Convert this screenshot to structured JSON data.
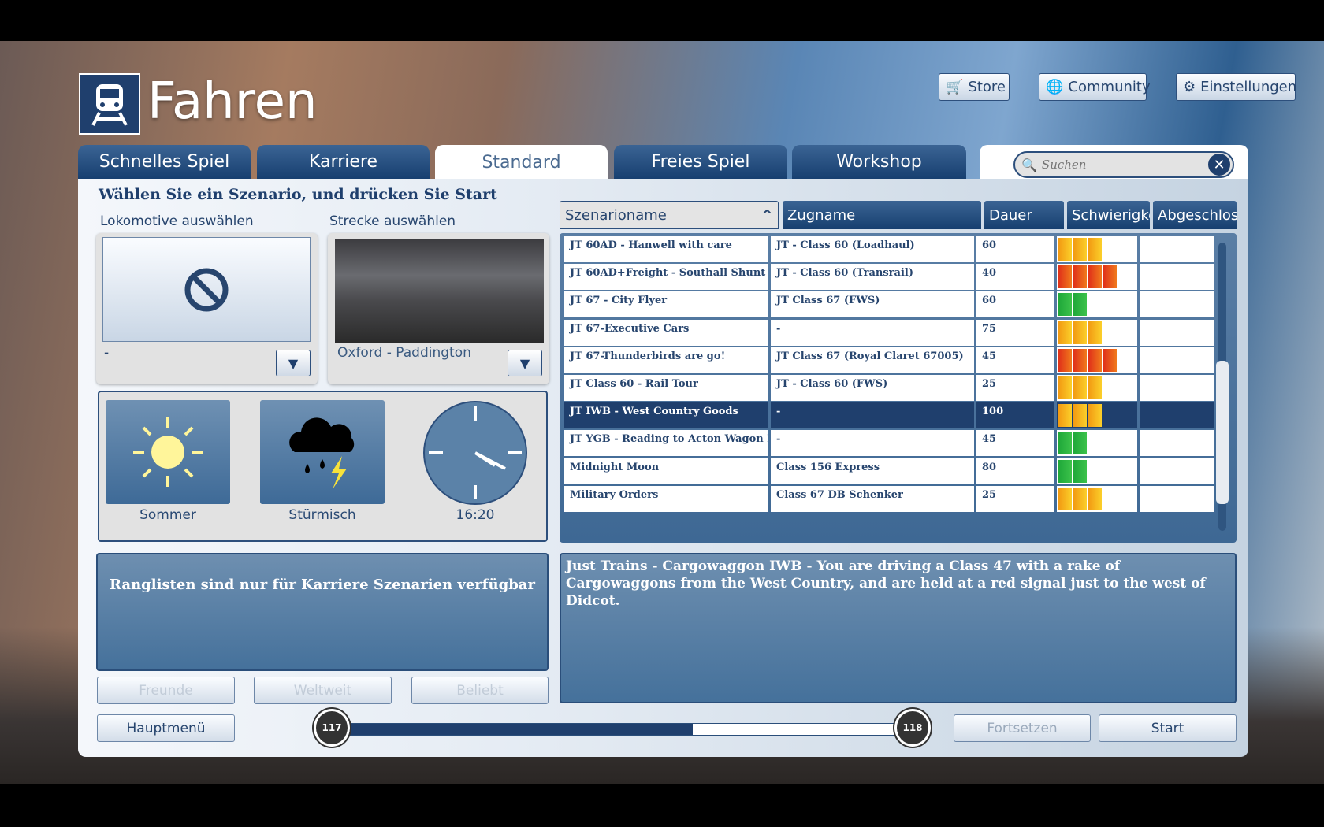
{
  "header": {
    "title": "Fahren",
    "logo_icon": "train-icon"
  },
  "top_buttons": [
    {
      "label": "Store",
      "icon": "cart-icon"
    },
    {
      "label": "Community",
      "icon": "globe-icon"
    },
    {
      "label": "Einstellungen",
      "icon": "gear-icon"
    }
  ],
  "tabs": [
    {
      "label": "Schnelles Spiel"
    },
    {
      "label": "Karriere"
    },
    {
      "label": "Standard",
      "active": true
    },
    {
      "label": "Freies Spiel"
    },
    {
      "label": "Workshop"
    }
  ],
  "search": {
    "placeholder": "Suchen",
    "value": ""
  },
  "main": {
    "heading": "Wählen Sie ein Szenario, und drücken Sie Start",
    "loco": {
      "label": "Lokomotive auswählen",
      "value": "-"
    },
    "route": {
      "label": "Strecke auswählen",
      "value": "Oxford - Paddington"
    },
    "season": "Sommer",
    "weather": "Stürmisch",
    "time": "16:20",
    "leaderboard_text": "Ranglisten sind nur für Karriere Szenarien verfügbar",
    "leader_buttons": [
      "Freunde",
      "Weltweit",
      "Beliebt"
    ]
  },
  "table": {
    "columns": [
      "Szenarioname",
      "Zugname",
      "Dauer",
      "Schwierigke",
      "Abgeschlos"
    ],
    "rows": [
      {
        "name": "JT 60AD - Hanwell with care",
        "train": "JT - Class 60 (Loadhaul)",
        "duration": "60",
        "difficulty": 3
      },
      {
        "name": "JT 60AD+Freight - Southall Shunt",
        "train": "JT - Class 60 (Transrail)",
        "duration": "40",
        "difficulty": 4
      },
      {
        "name": "JT 67 - City Flyer",
        "train": "JT Class 67 (FWS)",
        "duration": "60",
        "difficulty": 2
      },
      {
        "name": "JT 67-Executive Cars",
        "train": "-",
        "duration": "75",
        "difficulty": 3
      },
      {
        "name": "JT 67-Thunderbirds are go!",
        "train": "JT Class 67 (Royal Claret 67005)",
        "duration": "45",
        "difficulty": 4
      },
      {
        "name": "JT Class 60 - Rail Tour",
        "train": "JT - Class 60 (FWS)",
        "duration": "25",
        "difficulty": 3
      },
      {
        "name": "JT IWB - West Country Goods",
        "train": "-",
        "duration": "100",
        "difficulty": 3,
        "selected": true
      },
      {
        "name": "JT YGB - Reading to Acton Wagon Move",
        "train": "-",
        "duration": "45",
        "difficulty": 2
      },
      {
        "name": "Midnight Moon",
        "train": "Class 156 Express",
        "duration": "80",
        "difficulty": 2
      },
      {
        "name": "Military Orders",
        "train": "Class 67 DB Schenker",
        "duration": "25",
        "difficulty": 3
      }
    ]
  },
  "description": "Just Trains - Cargowaggon IWB - You are driving a Class 47 with a rake of Cargowaggons from the West Country, and are held at a red signal just to the west of Didcot.",
  "footer": {
    "main_menu": "Hauptmenü",
    "level_current": "117",
    "level_next": "118",
    "level_progress": 0.62,
    "continue": "Fortsetzen",
    "start": "Start"
  },
  "colors": {
    "easy": "#2db33c",
    "medium": "#f5b21e",
    "hard": "#e8401c",
    "primary": "#1f3f6d"
  }
}
